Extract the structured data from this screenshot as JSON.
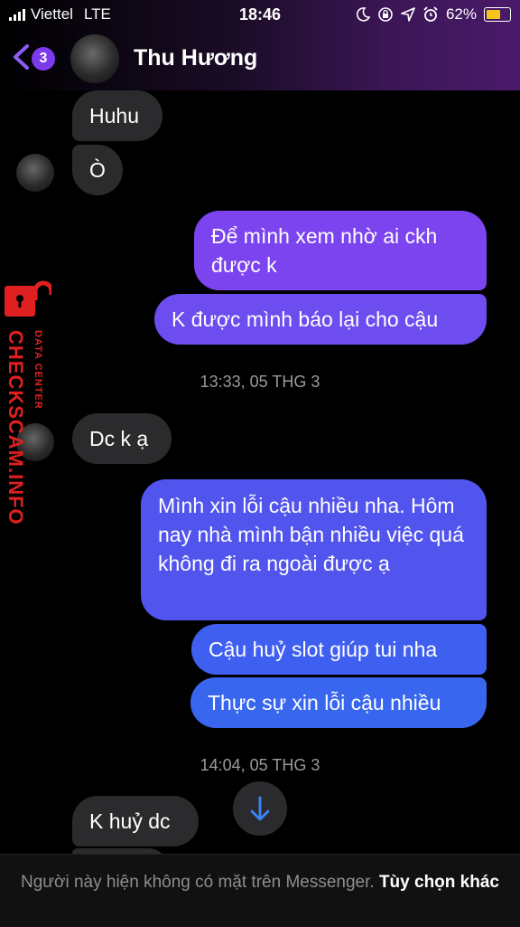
{
  "status_bar": {
    "carrier": "Viettel",
    "network": "LTE",
    "time": "18:46",
    "battery": "62%",
    "battery_level": 0.62,
    "icons": [
      "moon-icon",
      "orientation-lock-icon",
      "location-icon",
      "alarm-icon",
      "battery-icon"
    ]
  },
  "header": {
    "back_badge": "3",
    "contact_name": "Thu Hương",
    "accent_color": "#8b5cf6"
  },
  "messages": [
    {
      "side": "in",
      "text": "Huhu"
    },
    {
      "side": "in",
      "text": "Ò"
    },
    {
      "side": "out",
      "text": "Để mình xem nhờ ai ckh được k"
    },
    {
      "side": "out",
      "text": "K được mình báo lại cho cậu"
    },
    {
      "side": "in",
      "text": "Dc k ạ"
    },
    {
      "side": "out",
      "text": "Mình xin lỗi cậu nhiều nha. Hôm nay nhà mình bận nhiều việc quá không đi ra ngoài được ạ"
    },
    {
      "side": "out",
      "text": "Cậu huỷ slot giúp tui nha"
    },
    {
      "side": "out",
      "text": "Thực sự xin lỗi cậu nhiều"
    },
    {
      "side": "in",
      "text": "K huỷ dc"
    }
  ],
  "timestamps": [
    "13:33, 05 THG 3",
    "14:04, 05 THG 3"
  ],
  "watermark": {
    "main": "CHECKSCAM.INFO",
    "sub": "DATA CENTER",
    "color": "#e02020"
  },
  "footer": {
    "note": "Người này hiện không có mặt trên Messenger.",
    "link": "Tùy chọn khác"
  }
}
